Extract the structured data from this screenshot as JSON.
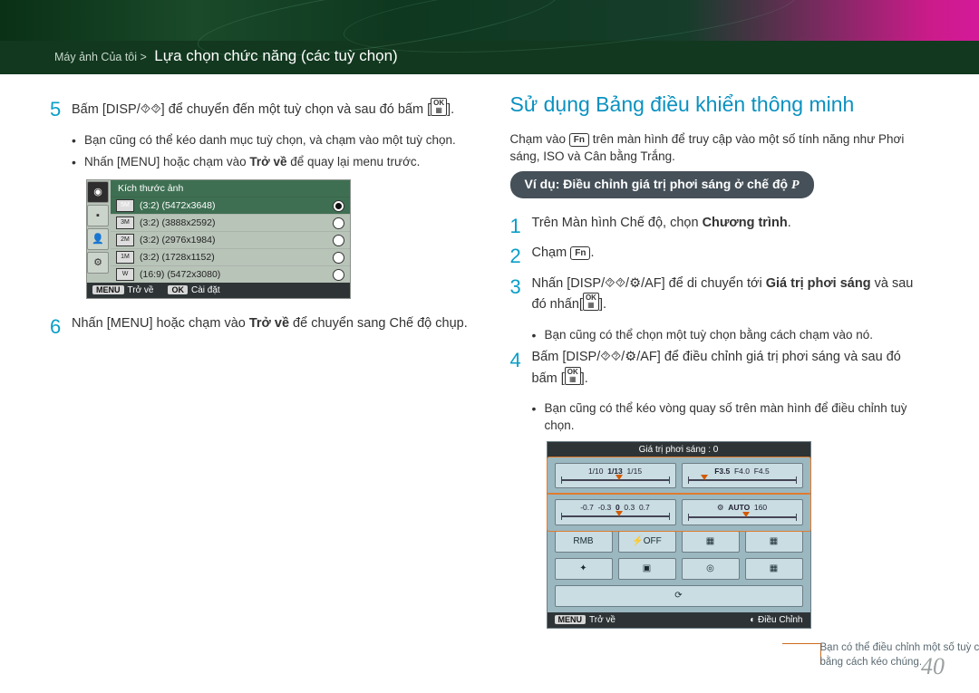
{
  "breadcrumb": {
    "root": "Máy ảnh Của tôi >",
    "section": "Lựa chọn chức năng (các tuỳ chọn)"
  },
  "left": {
    "step5": {
      "num": "5",
      "pre": "Bấm [",
      "k1": "DISP",
      "mid": "/",
      "k2": "⯑⯑",
      "post": "] để chuyển đến một tuỳ chọn và sau đó bấm [",
      "ok": "OK",
      "end": "]."
    },
    "b1": "Bạn cũng có thể kéo danh mục tuỳ chọn, và chạm vào một tuỳ chọn.",
    "b2": {
      "pre": "Nhấn [",
      "k": "MENU",
      "mid": "] hoặc chạm vào ",
      "bold": "Trở về",
      "post": " để quay lại menu trước."
    },
    "menu": {
      "title": "Kích thước ảnh",
      "rows": [
        {
          "ico": "5M",
          "label": "(3:2) (5472x3648)",
          "on": true
        },
        {
          "ico": "3M",
          "label": "(3:2) (3888x2592)",
          "on": false
        },
        {
          "ico": "2M",
          "label": "(3:2) (2976x1984)",
          "on": false
        },
        {
          "ico": "1M",
          "label": "(3:2) (1728x1152)",
          "on": false
        },
        {
          "ico": "W",
          "label": "(16:9) (5472x3080)",
          "on": false
        }
      ],
      "back": {
        "k": "MENU",
        "t": "Trở về"
      },
      "ok": {
        "k": "OK",
        "t": "Cài đặt"
      }
    },
    "step6": {
      "num": "6",
      "pre": "Nhấn [",
      "k": "MENU",
      "mid": "] hoặc chạm vào ",
      "bold": "Trở về",
      "post": " để chuyển sang Chế độ chụp."
    }
  },
  "right": {
    "h2": "Sử dụng Bảng điều khiển thông minh",
    "intro": {
      "pre": "Chạm vào ",
      "fn": "Fn",
      "post": " trên màn hình để truy cập vào một số tính năng như Phơi sáng, ISO và Cân bằng Trắng."
    },
    "pill": {
      "pre": "Ví dụ: Điều chỉnh giá trị phơi sáng ở chế độ ",
      "mode": "P"
    },
    "s1": {
      "num": "1",
      "pre": "Trên Màn hình Chế độ, chọn ",
      "bold": "Chương trình",
      "post": "."
    },
    "s2": {
      "num": "2",
      "pre": "Chạm ",
      "fn": "Fn",
      "post": "."
    },
    "s3": {
      "num": "3",
      "pre": "Nhấn [",
      "k1": "DISP",
      "k2": "⯑⯑",
      "k3": "⚙",
      "k4": "AF",
      "mid": "] để di chuyển tới ",
      "bold": "Giá trị phơi sáng",
      "post2": " và sau đó nhấn[",
      "ok": "OK",
      "end": "]."
    },
    "b3": "Bạn cũng có thể chọn một tuỳ chọn bằng cách chạm vào nó.",
    "s4": {
      "num": "4",
      "pre": "Bấm [",
      "k1": "DISP",
      "k2": "⯑⯑",
      "k3": "⚙",
      "k4": "AF",
      "mid": "] để điều chỉnh giá trị phơi sáng và sau đó bấm [",
      "ok": "OK",
      "end": "]."
    },
    "b4": "Bạn cũng có thể kéo vòng quay số trên màn hình để điều chỉnh tuỳ chọn.",
    "panel": {
      "title": "Giá trị phơi sáng : 0",
      "scale1": {
        "top": "1/13",
        "l1": "1/10",
        "l2": "1/13",
        "l3": "1/15",
        "r1": "F3.5",
        "r2": "F4.0",
        "r3": "F4.5"
      },
      "scale2": {
        "v": [
          "-0.7",
          "-0.3",
          "0",
          "0.3",
          "0.7"
        ],
        "w1": "⚙",
        "w2": "AUTO",
        "w3": "160"
      },
      "btns": [
        "RMB",
        "⚡OFF",
        "▦",
        "▦",
        "✦",
        "▣",
        "◎",
        "▦",
        "⟳"
      ],
      "back": {
        "k": "MENU",
        "t": "Trở về"
      },
      "adj": {
        "icon": "◐",
        "t": "Điều Chỉnh"
      }
    },
    "callout": "Bạn có thể điều chỉnh một số tuỳ chọn bằng cách kéo chúng."
  },
  "pagenum": "40"
}
